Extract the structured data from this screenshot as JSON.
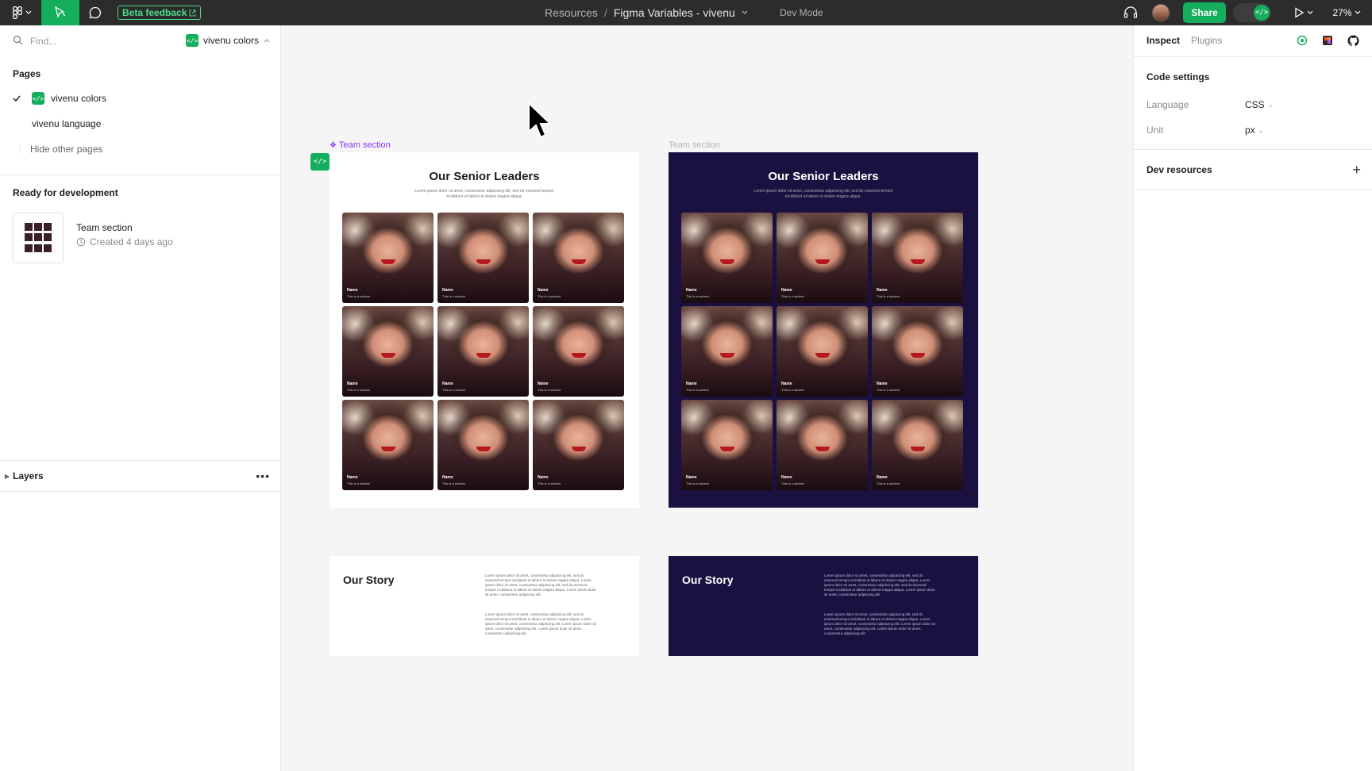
{
  "topbar": {
    "beta_feedback": "Beta feedback",
    "breadcrumb_project": "Resources",
    "breadcrumb_sep": "/",
    "file_name": "Figma Variables - vivenu",
    "dev_mode_label": "Dev Mode",
    "share_label": "Share",
    "zoom": "27%"
  },
  "left_panel": {
    "search_placeholder": "Find...",
    "current_page_badge": "vivenu colors",
    "pages_title": "Pages",
    "pages": [
      {
        "label": "vivenu colors",
        "selected": true
      },
      {
        "label": "vivenu language",
        "selected": false
      }
    ],
    "hide_pages": "Hide other pages",
    "ready_title": "Ready for development",
    "ready_item": {
      "name": "Team section",
      "time": "Created 4 days ago"
    },
    "layers_title": "Layers"
  },
  "canvas": {
    "frame_label_selected": "Team section",
    "frame_label_other": "Team section",
    "team_title": "Our Senior Leaders",
    "team_subtitle": "Lorem ipsum dolor sit amet, consectetur adipiscing elit, sed do eiusmod tempor incididunt ut labore et dolore magna aliqua.",
    "card_name": "Name",
    "card_subtitle": "This is a subtext",
    "story_title": "Our Story",
    "story_para_1": "Lorem ipsum dolor sit amet, consectetur adipiscing elit, sed do eiusmod tempor incididunt ut labore et dolore magna aliqua. Lorem ipsum dolor sit amet, consectetur adipiscing elit, sed do eiusmod tempor incididunt ut labore et dolore magna aliqua. Lorem ipsum dolor sit amet, consectetur adipiscing elit.",
    "story_para_2": "Lorem ipsum dolor sit amet, consectetur adipiscing elit, sed do eiusmod tempor incididunt ut labore et dolore magna aliqua. Lorem ipsum dolor sit amet, consectetur adipiscing elit. Lorem ipsum dolor sit amet, consectetur adipiscing elit. Lorem ipsum dolor sit amet, consectetur adipiscing elit.",
    "colors": {
      "light_bg": "#ffffff",
      "dark_bg": "#1b1140",
      "selection": "#8a38f5",
      "accent": "#14ae5c"
    }
  },
  "right_panel": {
    "tab_inspect": "Inspect",
    "tab_plugins": "Plugins",
    "code_settings_title": "Code settings",
    "language_label": "Language",
    "language_value": "CSS",
    "unit_label": "Unit",
    "unit_value": "px",
    "dev_resources_title": "Dev resources"
  },
  "icons": [
    "figma-menu-icon",
    "move-tool-icon",
    "comment-icon",
    "external-link-icon",
    "headset-icon",
    "play-icon",
    "search-icon",
    "code-icon",
    "checkmark-icon",
    "history-icon",
    "ellipsis-icon",
    "cursor-icon",
    "target-icon",
    "plugin-icon",
    "github-icon",
    "plus-icon"
  ]
}
